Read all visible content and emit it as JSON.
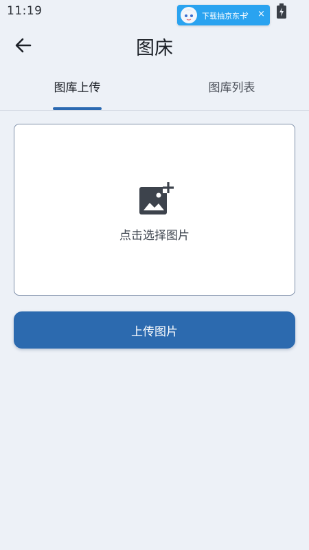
{
  "status_bar": {
    "time": "11:19",
    "icons": [
      "signal-icon",
      "battery-charging-icon"
    ]
  },
  "promo_banner": {
    "text": "下载抽京东卡",
    "chevron": "›",
    "close": "×"
  },
  "app_bar": {
    "back_icon": "arrow-left-icon",
    "title": "图床"
  },
  "tabs": [
    {
      "label": "图库上传",
      "selected": true
    },
    {
      "label": "图库列表",
      "selected": false
    }
  ],
  "upload_area": {
    "icon": "add-photo-icon",
    "hint": "点击选择图片"
  },
  "actions": {
    "upload_label": "上传图片"
  },
  "colors": {
    "background": "#edf1f7",
    "accent": "#2c6aaf",
    "card_border": "#7d8ea8",
    "promo": "#2aa3f0"
  }
}
